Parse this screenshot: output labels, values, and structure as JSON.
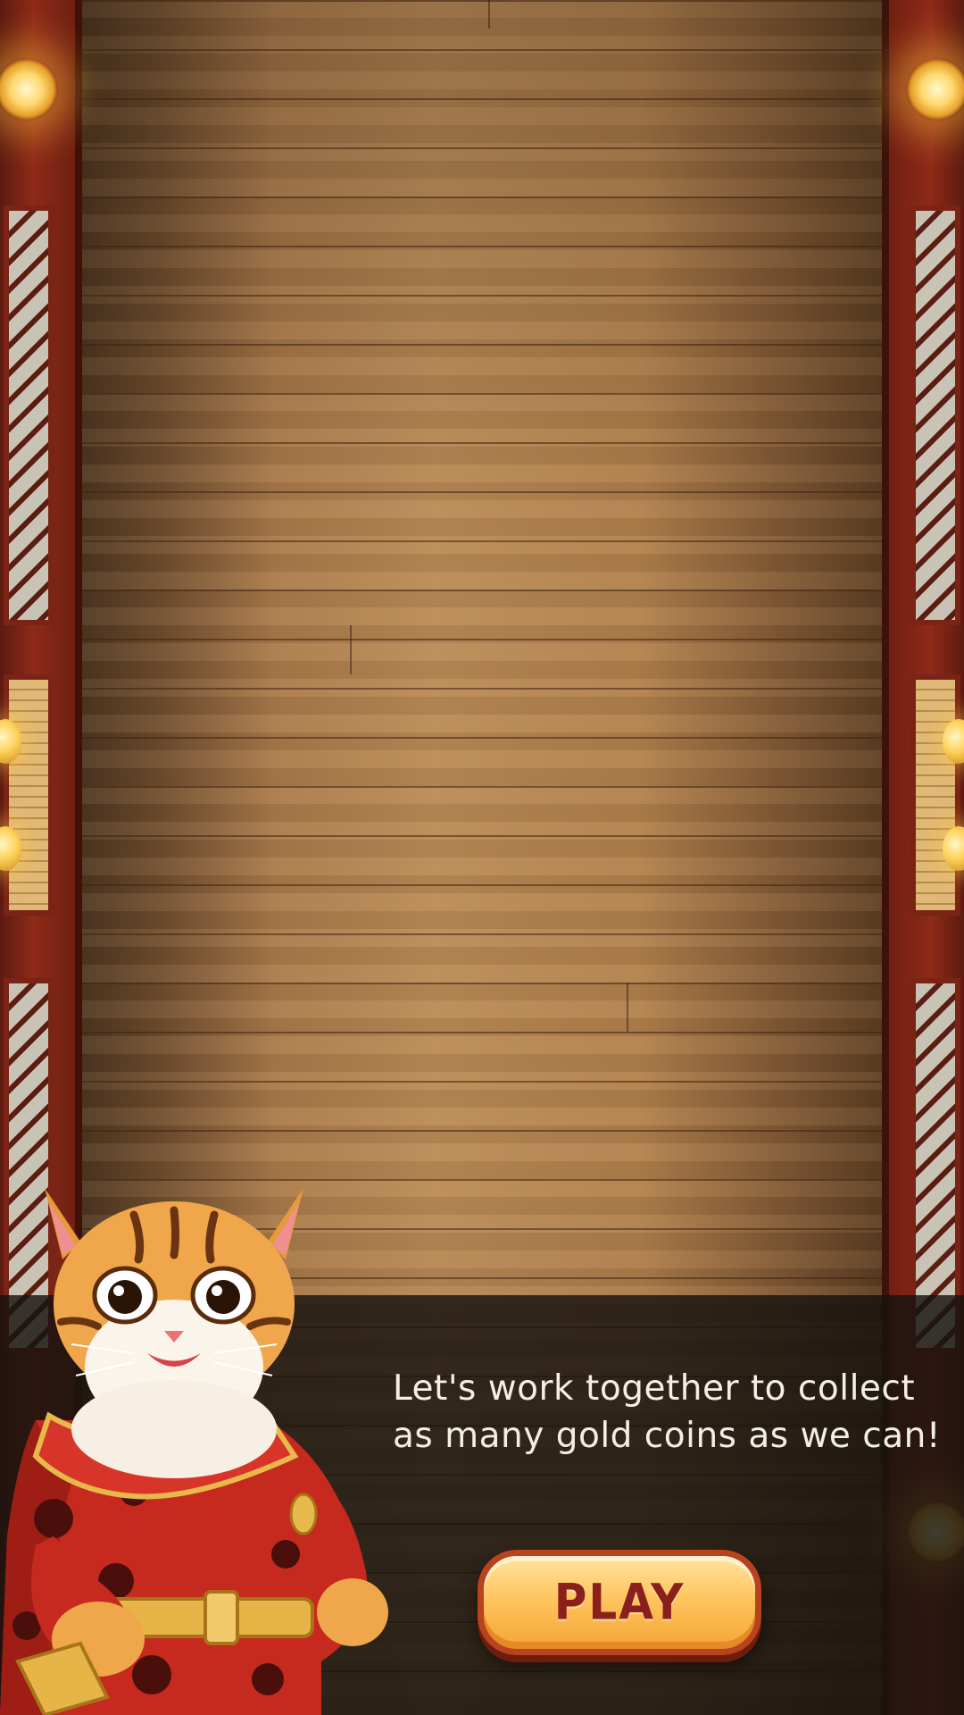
{
  "dialog": {
    "message_line1": "Let's work together to collect",
    "message_line2": "as many gold coins as we can!"
  },
  "play_button": {
    "label": "PLAY"
  },
  "mascot": {
    "name": "cat-mascot"
  },
  "colors": {
    "button_fill": "#ffc560",
    "button_border": "#b8431f",
    "button_text": "#8a1f1c",
    "wall_red": "#8e2a18",
    "floor_wood": "#b98a56",
    "dialog_bg": "#16120f"
  }
}
